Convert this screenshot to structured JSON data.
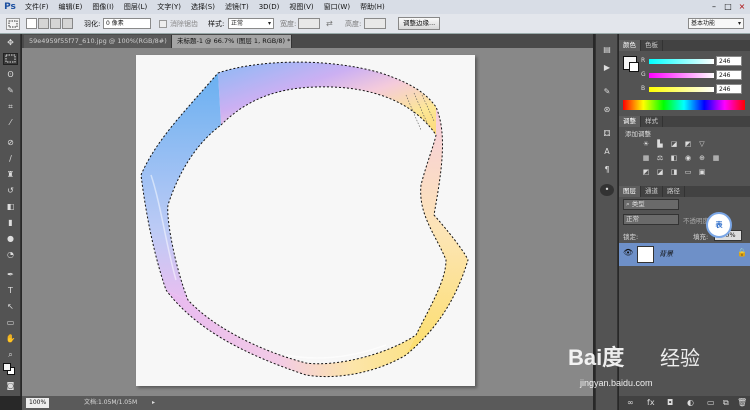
{
  "app": {
    "logo": "Ps"
  },
  "menubar": {
    "items": [
      "文件(F)",
      "编辑(E)",
      "图像(I)",
      "图层(L)",
      "文字(Y)",
      "选择(S)",
      "滤镜(T)",
      "3D(D)",
      "视图(V)",
      "窗口(W)",
      "帮助(H)"
    ]
  },
  "window_controls": {
    "minimize": "–",
    "restore": "□",
    "close": "×"
  },
  "options": {
    "feather_label": "羽化:",
    "feather_value": "0 像素",
    "antialias_label": "消除锯齿",
    "style_label": "样式:",
    "style_value": "正常",
    "width_label": "宽度:",
    "height_label": "高度:",
    "refine_button": "调整边缘...",
    "workspace": "基本功能"
  },
  "tabs": [
    {
      "label": "59e4959f55f77_610.jpg @ 100%(RGB/8#) *"
    },
    {
      "label": "未标题-1 @ 66.7% (图层 1, RGB/8) *"
    }
  ],
  "status": {
    "zoom": "100%",
    "doc_info": "文档:1.05M/1.05M"
  },
  "color_panel": {
    "tabs": [
      "颜色",
      "色板"
    ],
    "channels": [
      {
        "label": "R",
        "value": "246",
        "color": "#e84040"
      },
      {
        "label": "G",
        "value": "246",
        "color": "#e040d0"
      },
      {
        "label": "B",
        "value": "246",
        "color": "#e8d040"
      }
    ]
  },
  "adjust_panel": {
    "tabs": [
      "调整",
      "样式"
    ],
    "title": "添加调整"
  },
  "layers_panel": {
    "tabs": [
      "图层",
      "通道",
      "路径"
    ],
    "filter": "类型",
    "blend_mode": "正常",
    "opacity_label": "不透明度:",
    "lock_label": "锁定:",
    "fill_label": "填充:",
    "fill_value": "100%",
    "layer_name": "背景",
    "badge": "表"
  },
  "watermark": {
    "logo": "Bai度",
    "text": "经验",
    "url": "jingyan.baidu.com"
  },
  "icons": {
    "tools": [
      "move-icon",
      "marquee-icon",
      "lasso-icon",
      "quick-select-icon",
      "crop-icon",
      "eyedropper-icon",
      "healing-icon",
      "brush-icon",
      "stamp-icon",
      "history-brush-icon",
      "eraser-icon",
      "gradient-icon",
      "blur-icon",
      "dodge-icon",
      "pen-icon",
      "type-icon",
      "path-select-icon",
      "shape-icon",
      "hand-icon",
      "zoom-icon"
    ]
  }
}
